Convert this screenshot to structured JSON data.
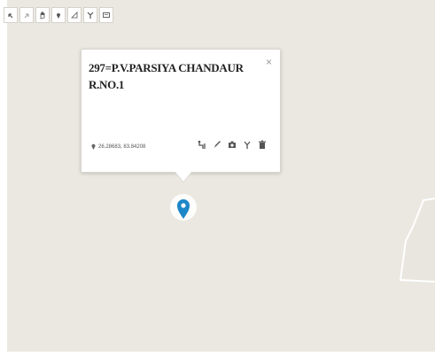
{
  "toolbar": {
    "tools": [
      "back-arrow-icon",
      "forward-arrow-icon",
      "hand-pan-icon",
      "add-marker-icon",
      "measure-icon",
      "filter-icon",
      "layers-icon"
    ]
  },
  "popup": {
    "title": "297=P.V.PARSIYA CHANDAUR R.NO.1",
    "close": "×",
    "coordinates": "26.28683, 83.84208",
    "actions": [
      "route-icon",
      "edit-icon",
      "camera-icon",
      "filter-icon",
      "delete-icon"
    ]
  },
  "colors": {
    "map_background": "#ebe8e1",
    "road": "#ffffff",
    "marker": "#1d87c8",
    "icon": "#555555"
  }
}
